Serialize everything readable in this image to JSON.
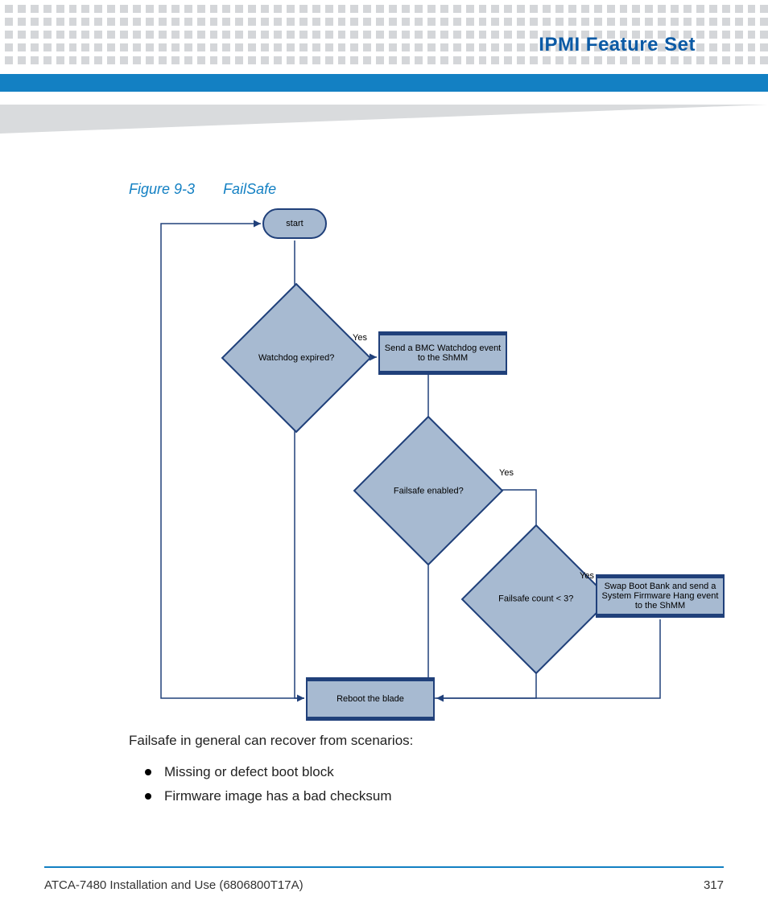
{
  "header": {
    "chapter_title": "IPMI Feature Set"
  },
  "figure": {
    "label": "Figure 9-3",
    "title": "FailSafe",
    "nodes": {
      "start": "start",
      "watchdog_expired": "Watchdog expired?",
      "send_event": "Send a BMC Watchdog event to the ShMM",
      "failsafe_enabled": "Failsafe enabled?",
      "failsafe_count": "Failsafe count < 3?",
      "swap": "Swap Boot Bank and send a System Firmware Hang event to the ShMM",
      "reboot": "Reboot the blade"
    },
    "edge_labels": {
      "yes1": "Yes",
      "yes2": "Yes",
      "yes3": "Yes"
    }
  },
  "body": {
    "intro": "Failsafe in general can recover from scenarios:",
    "bullets": [
      "Missing or defect boot block",
      "Firmware image has a bad checksum"
    ]
  },
  "footer": {
    "doc": "ATCA-7480 Installation and Use (6806800T17A)",
    "page": "317"
  }
}
